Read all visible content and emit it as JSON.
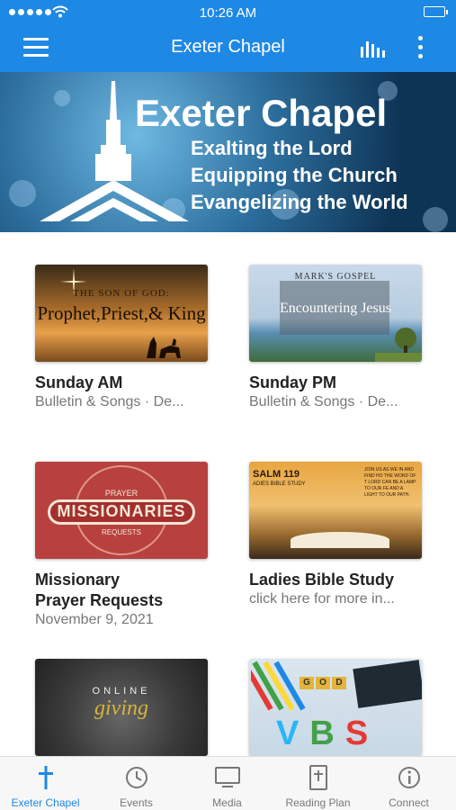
{
  "status_bar": {
    "time": "10:26 AM"
  },
  "header": {
    "title": "Exeter Chapel"
  },
  "banner": {
    "title": "Exeter Chapel",
    "lines": [
      "Exalting the Lord",
      "Equipping the Church",
      "Evangelizing the World"
    ]
  },
  "cards": [
    {
      "title": "Sunday AM",
      "subtitle": "Bulletin & Songs · De...",
      "thumb": {
        "line1": "THE SON OF GOD:",
        "line2": "Prophet,Priest,& King"
      }
    },
    {
      "title": "Sunday PM",
      "subtitle": "Bulletin & Songs · De...",
      "thumb": {
        "line1": "MARK'S GOSPEL",
        "line2": "Encountering Jesus"
      }
    },
    {
      "title": "Missionary Prayer Requests",
      "title_line1": "Missionary",
      "title_line2": "Prayer Requests",
      "subtitle": "November 9, 2021",
      "thumb": {
        "line1": "PRAYER",
        "line2": "MISSIONARIES",
        "line3": "REQUESTS"
      }
    },
    {
      "title": "Ladies Bible Study",
      "subtitle": "click here for more in...",
      "thumb": {
        "line1": "SALM 119",
        "line2": "ADIES BIBLE STUDY",
        "line3": "JOIN US AS WE IN AND FIND HO THE WORD OF T LORD CAN BE A LAMP TO OUR FE AND A LIGHT TO OUR PATH."
      }
    },
    {
      "title": "",
      "subtitle": "",
      "thumb": {
        "line1": "ONLINE",
        "line2": "giving"
      }
    },
    {
      "title": "",
      "subtitle": "",
      "thumb": {
        "letters": [
          "G",
          "O",
          "D"
        ],
        "vbs": [
          "V",
          "B",
          "S"
        ]
      }
    }
  ],
  "tabs": [
    {
      "label": "Exeter Chapel",
      "icon": "cross-icon",
      "active": true
    },
    {
      "label": "Events",
      "icon": "clock-icon"
    },
    {
      "label": "Media",
      "icon": "monitor-icon"
    },
    {
      "label": "Reading Plan",
      "icon": "bible-icon"
    },
    {
      "label": "Connect",
      "icon": "info-icon"
    }
  ],
  "colors": {
    "primary": "#1e88e5",
    "tab_inactive": "#777777",
    "card_title": "#222222",
    "card_subtitle": "#777777"
  }
}
